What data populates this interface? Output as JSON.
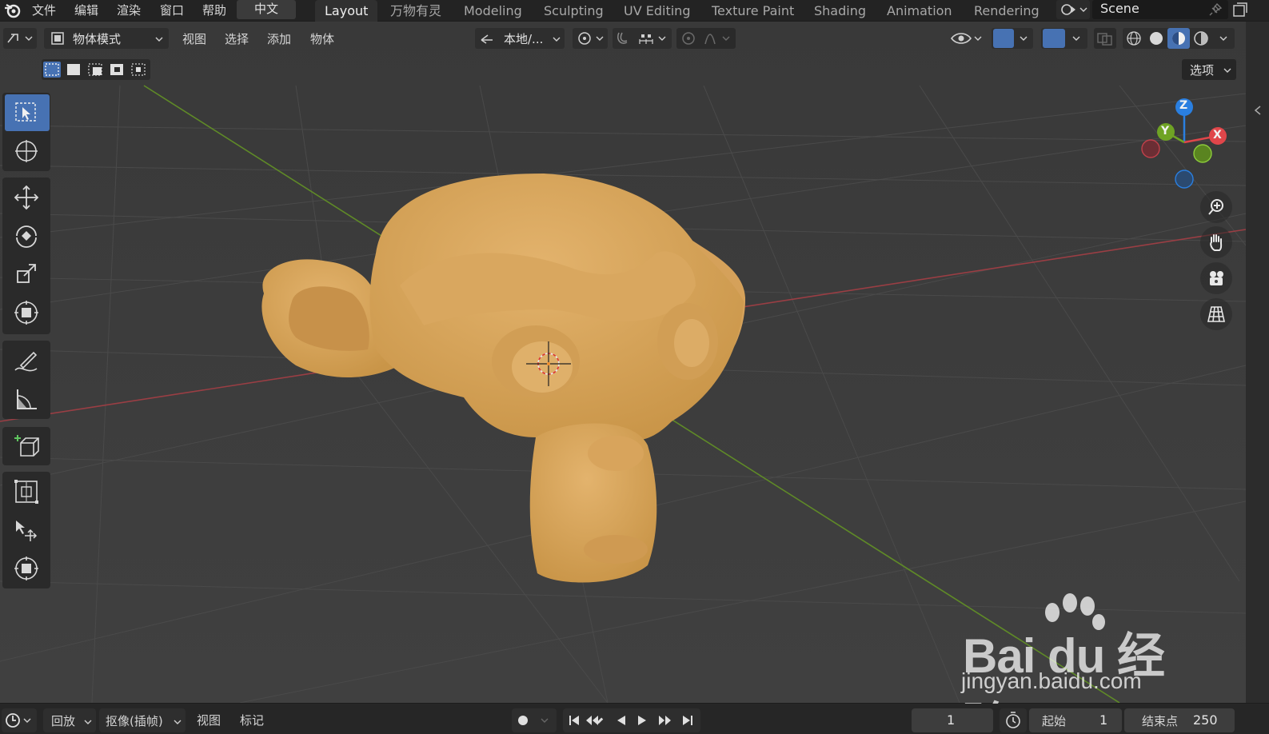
{
  "menu": {
    "items": [
      "文件",
      "编辑",
      "渲染",
      "窗口",
      "帮助"
    ],
    "language": "中文"
  },
  "workspaces": [
    "Layout",
    "万物有灵",
    "Modeling",
    "Sculpting",
    "UV Editing",
    "Texture Paint",
    "Shading",
    "Animation",
    "Rendering"
  ],
  "active_workspace": "Layout",
  "scene": {
    "name": "Scene"
  },
  "viewport_header": {
    "mode": "物体模式",
    "menus": [
      "视图",
      "选择",
      "添加",
      "物体"
    ],
    "transform_orientation": "本地/...",
    "options": "选项"
  },
  "gizmo": {
    "z": "Z",
    "y": "Y",
    "x": "X"
  },
  "timeline": {
    "playback": "回放",
    "keying": "抠像(插帧)",
    "view": "视图",
    "markers": "标记",
    "current_frame": "1",
    "start_label": "起始",
    "start_value": "1",
    "end_label": "结束点",
    "end_value": "250"
  },
  "watermark": {
    "brand": "Bai  du 经验",
    "url": "jingyan.baidu.com"
  },
  "colors": {
    "accent": "#4772b3",
    "axis_x": "#e0464a",
    "axis_y": "#6fa324",
    "axis_z": "#2a7fe0",
    "monkey": "#dba65c"
  },
  "tool_icons": [
    "select-box-icon",
    "cursor-icon",
    "move-icon",
    "rotate-icon",
    "scale-icon",
    "transform-icon",
    "annotate-icon",
    "measure-icon",
    "add-cube-icon",
    "scale-cage-icon",
    "shrink-icon",
    "transform-alt-icon"
  ]
}
